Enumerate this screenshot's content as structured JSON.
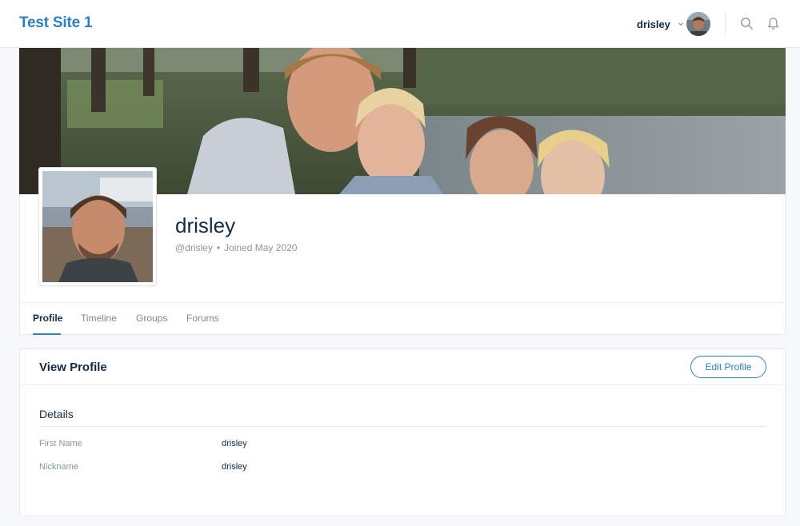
{
  "header": {
    "site_title": "Test Site 1",
    "user_name": "drisley"
  },
  "profile": {
    "display_name": "drisley",
    "handle": "@drisley",
    "separator": "•",
    "joined": "Joined May 2020"
  },
  "tabs": [
    {
      "label": "Profile",
      "active": true
    },
    {
      "label": "Timeline",
      "active": false
    },
    {
      "label": "Groups",
      "active": false
    },
    {
      "label": "Forums",
      "active": false
    }
  ],
  "view_profile": {
    "title": "View Profile",
    "edit_label": "Edit Profile",
    "section_title": "Details",
    "fields": [
      {
        "label": "First Name",
        "value": "drisley"
      },
      {
        "label": "Nickname",
        "value": "drisley"
      }
    ]
  },
  "colors": {
    "accent": "#2c80c4",
    "heading": "#122b46",
    "muted": "#8a949f"
  }
}
